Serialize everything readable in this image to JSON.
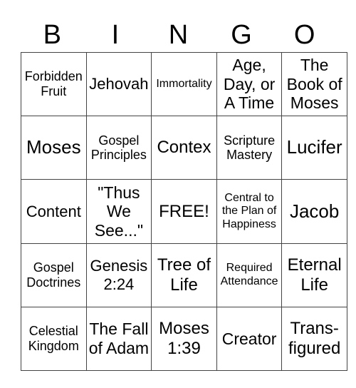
{
  "header": {
    "letters": [
      "B",
      "I",
      "N",
      "G",
      "O"
    ]
  },
  "card": {
    "rows": [
      [
        "Forbidden Fruit",
        "Jehovah",
        "Immortality",
        "Age, Day, or A Time",
        "The Book of Moses"
      ],
      [
        "Moses",
        "Gospel Principles",
        "Contex",
        "Scripture Mastery",
        "Lucifer"
      ],
      [
        "Content",
        "\"Thus We See...\"",
        "FREE!",
        "Central to the Plan of Happiness",
        "Jacob"
      ],
      [
        "Gospel Doctrines",
        "Genesis 2:24",
        "Tree of Life",
        "Required Attendance",
        "Eternal Life"
      ],
      [
        "Celestial Kingdom",
        "The Fall of Adam",
        "Moses 1:39",
        "Creator",
        "Trans-figured"
      ]
    ]
  }
}
